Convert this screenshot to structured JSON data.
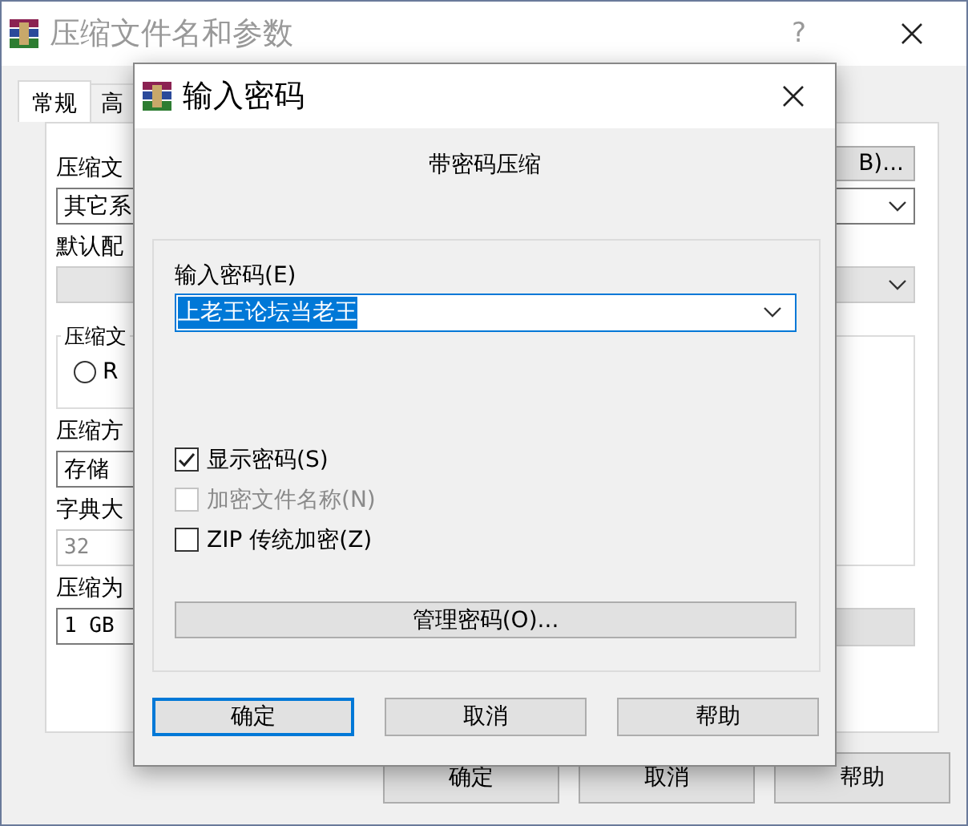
{
  "main_window": {
    "title": "压缩文件名和参数",
    "help_glyph": "?",
    "tabs": [
      {
        "label": "常规",
        "selected": true
      },
      {
        "label": "高",
        "selected": false
      }
    ],
    "panel_items": [
      {
        "kind": "label",
        "text": "压缩文",
        "button": "B)..."
      },
      {
        "kind": "combo",
        "value": "其它系",
        "disabled": false
      },
      {
        "kind": "label",
        "text": "默认配"
      },
      {
        "kind": "combo",
        "disabled": true
      },
      {
        "kind": "group",
        "title": "压缩文",
        "radio": {
          "label": "R",
          "selected": false
        }
      },
      {
        "kind": "label",
        "text": "压缩方"
      },
      {
        "kind": "combo",
        "value": "存储",
        "disabled": false
      },
      {
        "kind": "label",
        "text": "字典大"
      },
      {
        "kind": "field",
        "value": "32",
        "disabled": true
      },
      {
        "kind": "label",
        "text": "压缩为"
      },
      {
        "kind": "field",
        "value": "1 GB",
        "disabled": false
      }
    ],
    "buttons": [
      "确定",
      "取消",
      "帮助"
    ]
  },
  "password_dialog": {
    "title": "输入密码",
    "heading": "带密码压缩",
    "password_label": "输入密码(E)",
    "password_value": "上老王论坛当老王",
    "password_selected": true,
    "options": [
      {
        "label": "显示密码(S)",
        "checked": true,
        "disabled": false
      },
      {
        "label": "加密文件名称(N)",
        "checked": false,
        "disabled": true
      },
      {
        "label": "ZIP 传统加密(Z)",
        "checked": false,
        "disabled": false
      }
    ],
    "manage_button": "管理密码(O)...",
    "buttons": [
      {
        "label": "确定",
        "default": true
      },
      {
        "label": "取消",
        "default": false
      },
      {
        "label": "帮助",
        "default": false
      }
    ]
  }
}
